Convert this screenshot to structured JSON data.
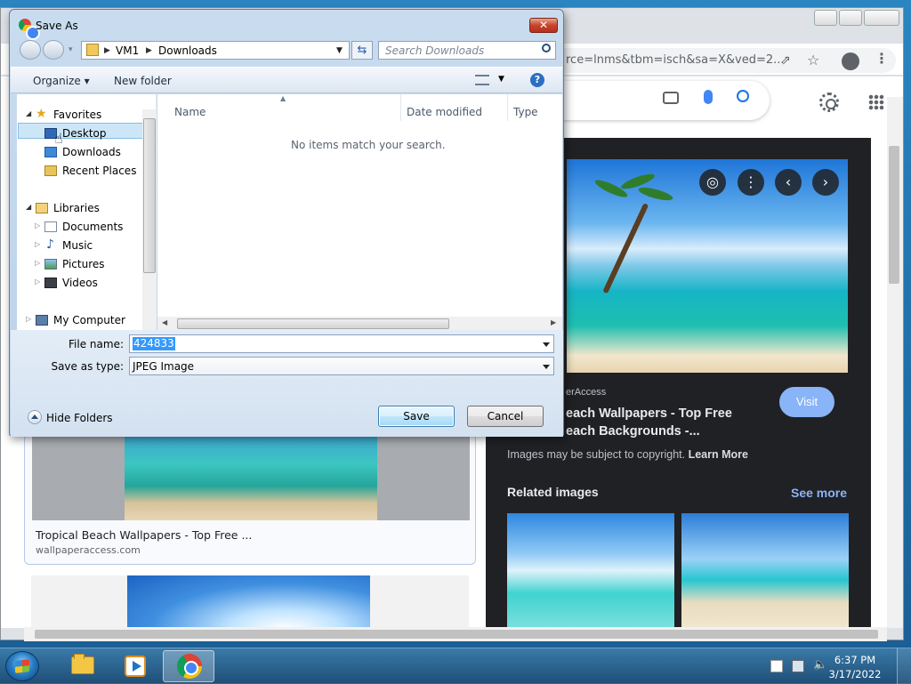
{
  "dialog": {
    "title": "Save As",
    "address": [
      "VM1",
      "Downloads"
    ],
    "search_placeholder": "Search Downloads",
    "organize_label": "Organize",
    "new_folder_label": "New folder",
    "tree": {
      "favorites": "Favorites",
      "desktop": "Desktop",
      "downloads": "Downloads",
      "recent_places": "Recent Places",
      "libraries": "Libraries",
      "documents": "Documents",
      "music": "Music",
      "pictures": "Pictures",
      "videos": "Videos",
      "my_computer": "My Computer"
    },
    "columns": [
      "Name",
      "Date modified",
      "Type"
    ],
    "empty_message": "No items match your search.",
    "file_name_label": "File name:",
    "file_name_value": "424833",
    "save_type_label": "Save as type:",
    "save_type_value": "JPEG Image",
    "hide_folders_label": "Hide Folders",
    "save_label": "Save",
    "cancel_label": "Cancel"
  },
  "browser": {
    "url_fragment": "rce=lnms&tbm=isch&sa=X&ved=2...",
    "result_card": {
      "title": "Tropical Beach Wallpapers - Top Free ...",
      "site": "wallpaperaccess.com"
    },
    "panel": {
      "source": "erAccess",
      "title_line1": "each Wallpapers - Top Free",
      "title_line2": "each Backgrounds -...",
      "visit_label": "Visit",
      "copyright_text": "Images may be subject to copyright.",
      "learn_more": "Learn More",
      "related_heading": "Related images",
      "see_more": "See more"
    }
  },
  "taskbar": {
    "time": "6:37 PM",
    "date": "3/17/2022"
  },
  "colors": {
    "selection": "#3399ff",
    "panel_bg": "#202124",
    "link_blue": "#8ab4f8",
    "dialog_frame": "#bcd2ea"
  }
}
